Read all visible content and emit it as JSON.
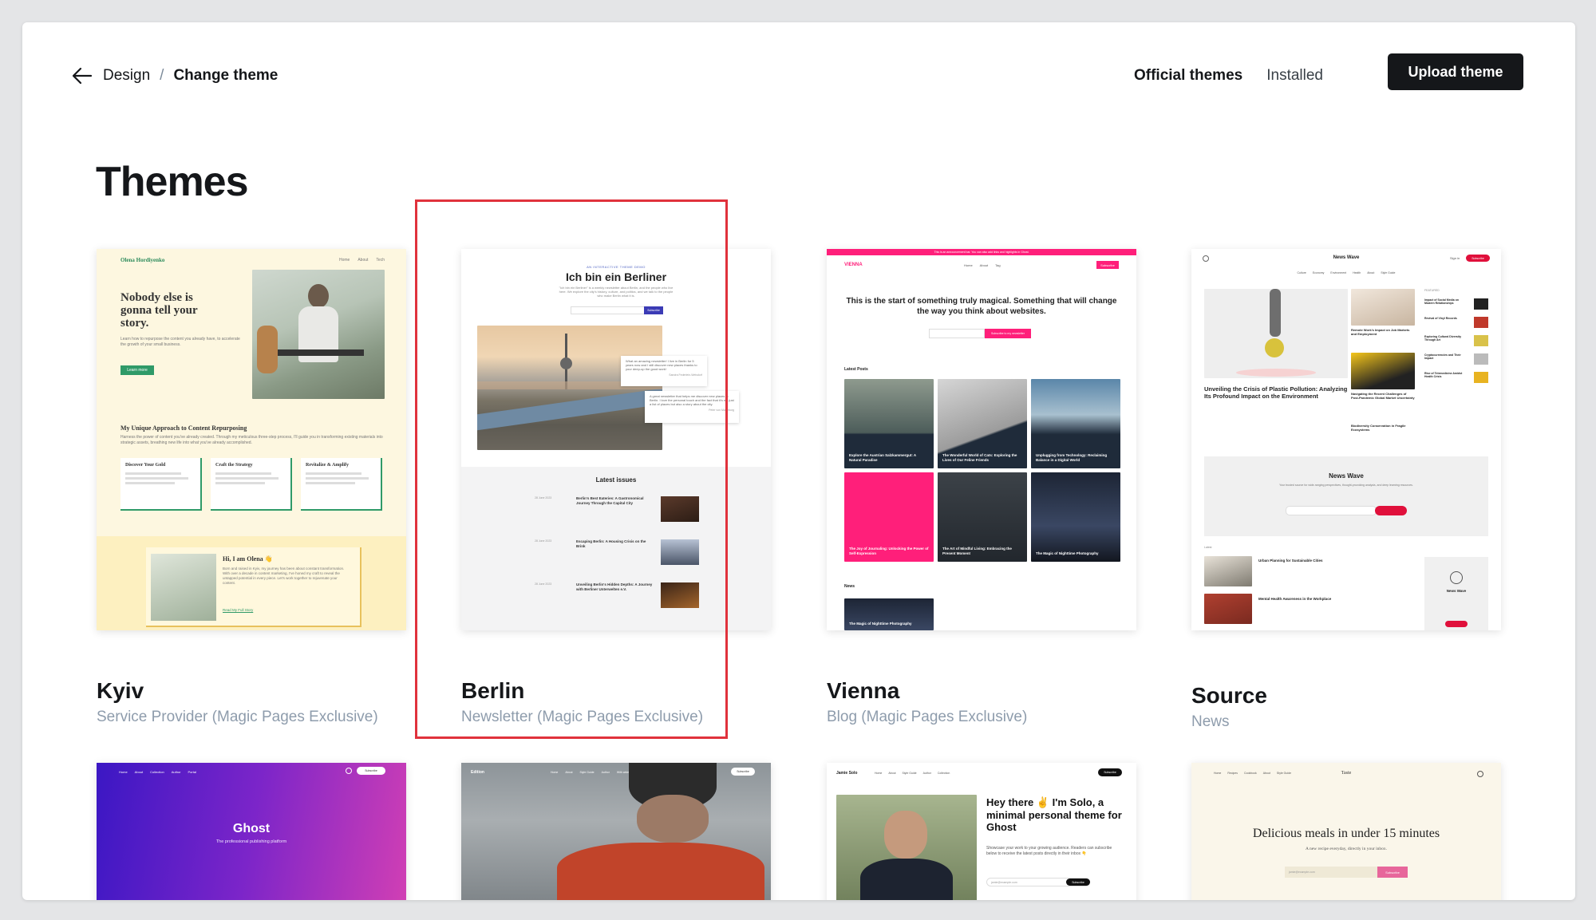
{
  "breadcrumb": {
    "parent": "Design",
    "separator": "/",
    "current": "Change theme"
  },
  "tabs": [
    "Official themes",
    "Installed"
  ],
  "upload_label": "Upload theme",
  "page_title": "Themes",
  "themes": [
    {
      "name": "Kyiv",
      "category": "Service Provider (Magic Pages Exclusive)",
      "preview": {
        "brand": "Olena Hordiyenko",
        "nav": [
          "Home",
          "About",
          "Tech"
        ],
        "hero": "Nobody else is gonna tell your story.",
        "hero_sub": "Learn how to repurpose the content you already have, to accelerate the growth of your small business.",
        "button": "Learn more",
        "section": "My Unique Approach to Content Repurposing",
        "section_sub": "Harness the power of content you've already created. Through my meticulous three-step process, I'll guide you in transforming existing materials into strategic assets, breathing new life into what you've already accomplished.",
        "steps": [
          "Discover Your Gold",
          "Craft the Strategy",
          "Revitalize & Amplify"
        ],
        "bio_title": "Hi, I am Olena 👋",
        "bio_text": "Born and raised in Kyiv, my journey has been about constant transformation. With over a decade in content marketing, I've honed my craft to reveal the untapped potential in every piece. Let's work together to rejuvenate your content.",
        "bio_link": "Read My Full Story"
      }
    },
    {
      "name": "Berlin",
      "category": "Newsletter (Magic Pages Exclusive)",
      "preview": {
        "kicker": "AN INTERACTIVE THEME DEMO",
        "title": "Ich bin ein Berliner",
        "sub": "\"Ich bin ein Berliner\" is a weekly newsletter about Berlin, and the people who live here. We explore the city's history, culture, and politics, and we talk to the people who make Berlin what it is.",
        "subscribe": "Subscribe",
        "quote1": "What an amazing newsletter! I live in Berlin for 5 years now and I still discover new places thanks to your deep-up the good work!",
        "quote1_by": "Sandra Federlein-Weisdorf",
        "quote2": "A great newsletter that helps me discover new places in Berlin. I love the personal touch and the fact that it's not just a list of places but also a story about the city.",
        "quote2_by": "Peter von Marteburg",
        "latest": "Latest issues",
        "issues": [
          {
            "date": "28 June 2023",
            "title": "Berlin's Best Eateries: A Gastronomical Journey Through the Capital City"
          },
          {
            "date": "28 June 2023",
            "title": "Escaping Berlin: A Housing Crisis on the Brink"
          },
          {
            "date": "28 June 2023",
            "title": "Unveiling Berlin's Hidden Depths: A Journey with Berliner Unterwelten e.V."
          }
        ]
      }
    },
    {
      "name": "Vienna",
      "category": "Blog (Magic Pages Exclusive)",
      "preview": {
        "banner": "This is an announcement bar. You can also add links and highlights in Ghost.",
        "brand": "VIENNA",
        "nav": [
          "Home",
          "About",
          "Tag"
        ],
        "subscribe": "Subscribe",
        "hero": "This is the start of something truly magical. Something that will change the way you think about websites.",
        "cta": "Subscribe to my newsletter",
        "latest": "Latest Posts",
        "posts": [
          "Explore the Austrian Salzkammergut: A Natural Paradise",
          "The Wonderful World of Cats: Exploring the Lives of Our Feline Friends",
          "Unplugging from Technology: Reclaiming Balance in a Digital World",
          "The Joy of Journaling: Unlocking the Power of Self-Expression",
          "The Art of Mindful Living: Embracing the Present Moment",
          "The Magic of Nighttime Photography"
        ],
        "news": "News",
        "news_post": "The Magic of Nighttime Photography"
      }
    },
    {
      "name": "Source",
      "category": "News",
      "preview": {
        "brand": "News Wave",
        "signin": "Sign in",
        "subscribe": "Subscribe",
        "nav": [
          "Culture",
          "Economy",
          "Environment",
          "Health",
          "About",
          "Style Guide"
        ],
        "feature": "Unveiling the Crisis of Plastic Pollution: Analyzing Its Profound Impact on the Environment",
        "mid": [
          "Remote Work's Impact on Job Markets and Employment",
          "Navigating the Recent Challenges of Post-Pandemic Global Market Uncertainty",
          "Biodiversity Conservation in Fragile Ecosystems"
        ],
        "featured_label": "FEATURED",
        "side": [
          "Impact of Social Media on Modern Relationships",
          "Revival of Vinyl Records",
          "Exploring Cultural Diversity Through Art",
          "Cryptocurrencies and Their Impact",
          "Rise of Telemedicine Amidst Health Crisis"
        ],
        "box_title": "News Wave",
        "box_sub": "Your trusted source for wide-ranging perspectives, thought-provoking analysis, and deep learning resources.",
        "latest": "Latest",
        "latest_posts": [
          "Urban Planning for Sustainable Cities",
          "Mental Health Awareness in the Workplace"
        ]
      }
    },
    {
      "name": "Ghost",
      "category": "",
      "preview": {
        "nav": [
          "Home",
          "About",
          "Collection",
          "Author",
          "Portal"
        ],
        "subscribe": "Subscribe",
        "title": "Ghost",
        "sub": "The professional publishing platform"
      }
    },
    {
      "name": "Edition",
      "category": "",
      "preview": {
        "brand": "Edition",
        "nav": [
          "Home",
          "About",
          "Style Guide",
          "Author",
          "With wide image"
        ],
        "subscribe": "Subscribe"
      }
    },
    {
      "name": "Solo",
      "category": "",
      "preview": {
        "brand": "Jamie Solo",
        "nav": [
          "Home",
          "About",
          "Style Guide",
          "Author",
          "Collection"
        ],
        "subscribe": "Subscribe",
        "title": "Hey there ✌️ I'm Solo, a minimal personal theme for Ghost",
        "sub": "Showcase your work to your growing audience. Readers can subscribe below to receive the latest posts directly in their inbox 👇",
        "placeholder": "jamie@example.com",
        "button": "Subscribe"
      }
    },
    {
      "name": "Taste",
      "category": "",
      "preview": {
        "brand": "Taste",
        "nav": [
          "Home",
          "Recipes",
          "Cookbook",
          "About",
          "Style Guide"
        ],
        "title": "Delicious meals in under 15 minutes",
        "sub": "A new recipe everyday, directly in your inbox.",
        "placeholder": "jamie@example.com",
        "button": "Subscribe"
      }
    }
  ]
}
